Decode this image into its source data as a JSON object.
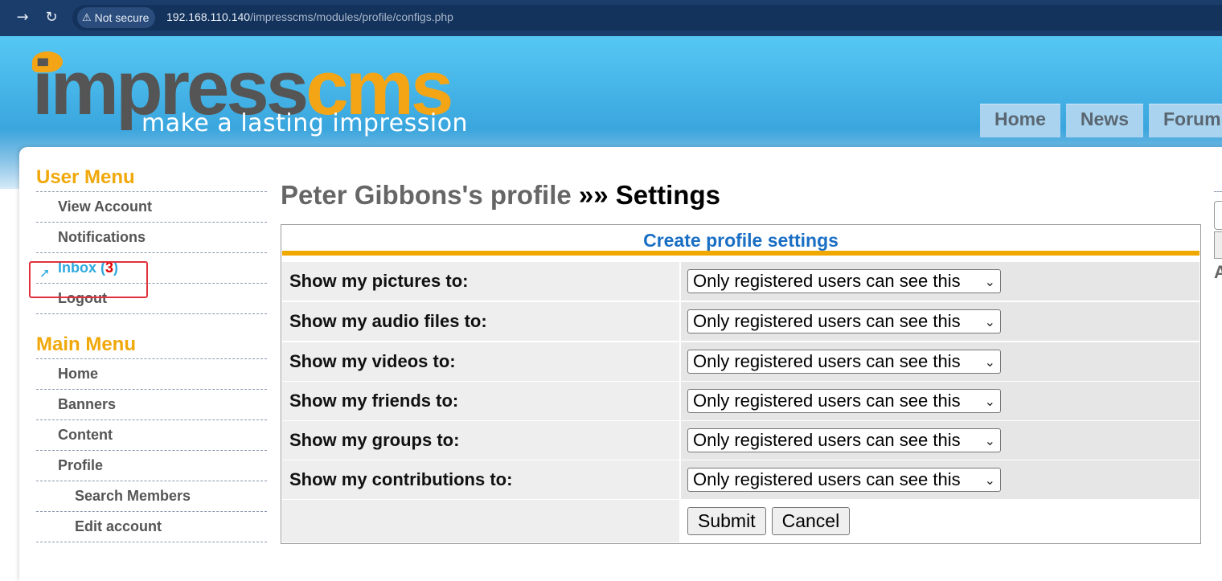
{
  "browser": {
    "back_icon": "arrow-right-icon",
    "reload_icon": "reload-icon",
    "security_label": "Not secure",
    "url_host": "192.168.110.140",
    "url_path": "/impresscms/modules/profile/configs.php"
  },
  "header": {
    "logo_impress": "impress",
    "logo_cms": "cms",
    "tagline": "make a lasting impression",
    "nav": [
      "Home",
      "News",
      "Forum"
    ]
  },
  "sidebar": {
    "user_menu": {
      "title": "User Menu",
      "items": [
        "View Account",
        "Notifications",
        "Inbox",
        "Logout"
      ],
      "inbox_open": "(",
      "inbox_count": "3",
      "inbox_close": ")"
    },
    "main_menu": {
      "title": "Main Menu",
      "items": [
        "Home",
        "Banners",
        "Content",
        "Profile"
      ],
      "sub_items": [
        "Search Members",
        "Edit account"
      ]
    }
  },
  "main": {
    "title_owner": "Peter Gibbons's profile",
    "title_sep": " »» ",
    "title_page": "Settings",
    "form": {
      "header": "Create profile settings",
      "rows": [
        {
          "label": "Show my pictures to:",
          "value": "Only registered users can see this"
        },
        {
          "label": "Show my audio files to:",
          "value": "Only registered users can see this"
        },
        {
          "label": "Show my videos to:",
          "value": "Only registered users can see this"
        },
        {
          "label": "Show my friends to:",
          "value": "Only registered users can see this"
        },
        {
          "label": "Show my groups to:",
          "value": "Only registered users can see this"
        },
        {
          "label": "Show my contributions to:",
          "value": "Only registered users can see this"
        }
      ],
      "submit_label": "Submit",
      "cancel_label": "Cancel"
    }
  },
  "right_partial_text": "A",
  "colors": {
    "accent_orange": "#f0a80a",
    "link_blue": "#2eaadf",
    "header_blue": "#1a6fc4",
    "highlight_red": "#e0323c"
  }
}
